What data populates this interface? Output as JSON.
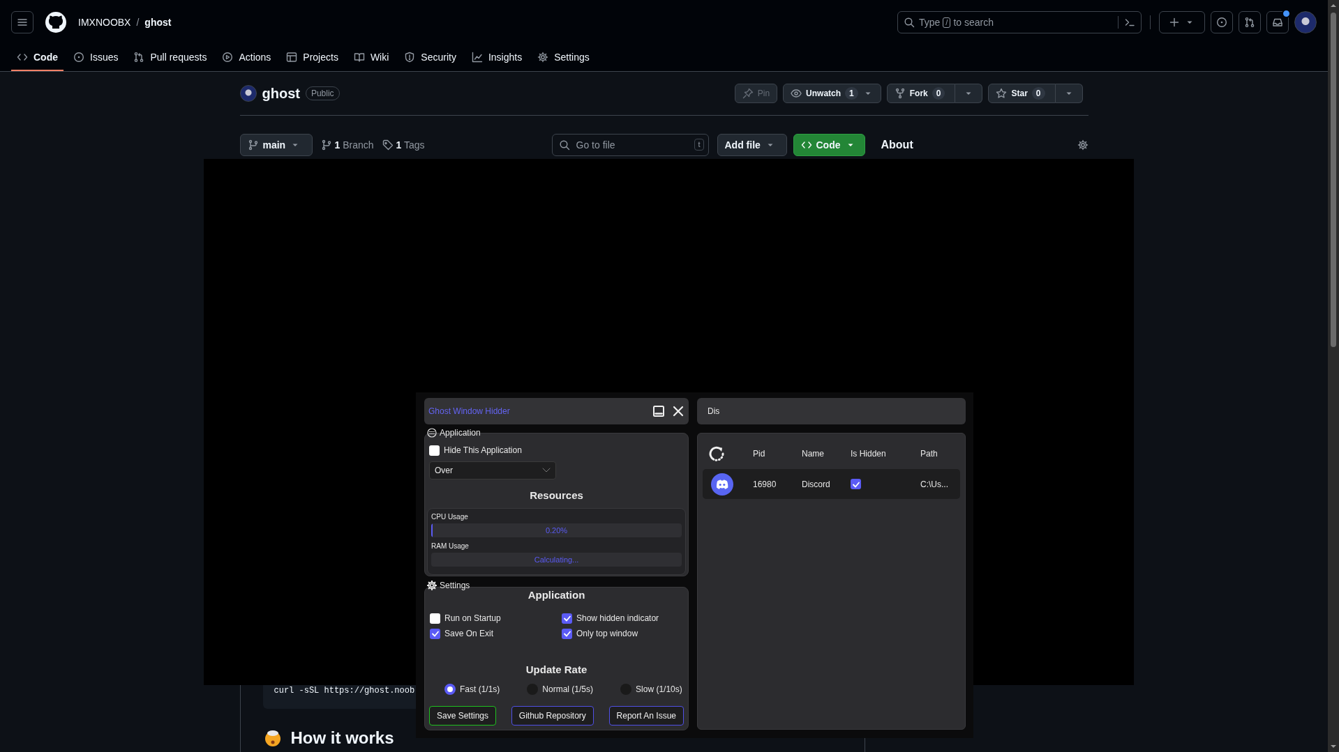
{
  "header": {
    "owner": "IMXNOOBX",
    "separator": "/",
    "repo": "ghost",
    "search": {
      "before": "Type",
      "key": "/",
      "after": "to search"
    },
    "unread": true
  },
  "nav": [
    {
      "kind": "code",
      "label": "Code",
      "selected": true
    },
    {
      "kind": "issues",
      "label": "Issues",
      "selected": false
    },
    {
      "kind": "pulls",
      "label": "Pull requests",
      "selected": false
    },
    {
      "kind": "actions",
      "label": "Actions",
      "selected": false
    },
    {
      "kind": "projects",
      "label": "Projects",
      "selected": false
    },
    {
      "kind": "wiki",
      "label": "Wiki",
      "selected": false
    },
    {
      "kind": "security",
      "label": "Security",
      "selected": false
    },
    {
      "kind": "insights",
      "label": "Insights",
      "selected": false
    },
    {
      "kind": "settings",
      "label": "Settings",
      "selected": false
    }
  ],
  "repo": {
    "name": "ghost",
    "visibility": "Public",
    "actions": [
      {
        "kind": "pin",
        "label": "Pin",
        "disabled": true
      },
      {
        "kind": "watch",
        "label": "Unwatch",
        "count": "1",
        "disabled": false
      },
      {
        "kind": "fork",
        "label": "Fork",
        "count": "0",
        "disabled": false
      },
      {
        "kind": "star",
        "label": "Star",
        "count": "0",
        "disabled": false
      }
    ]
  },
  "file_bar": {
    "branch": "main",
    "branches": "**1** Branch",
    "tags": "**1** Tags",
    "go_to_file": {
      "placeholder": "Go to file",
      "shortcut": "t"
    },
    "add_file": "Add file",
    "code": "Code",
    "about": "About"
  },
  "readme": {
    "code": "curl -sSL https://ghost.noob",
    "heading": "How it works"
  },
  "app": {
    "title": "Ghost Window Hidder",
    "application": {
      "label": "Application",
      "hide": {
        "label": "Hide This Application",
        "checked": false
      },
      "mode": "Over"
    },
    "resources": {
      "title": "Resources",
      "meters": [
        {
          "label": "CPU Usage",
          "level": 0.002,
          "reading": "0.20%"
        },
        {
          "label": "RAM Usage",
          "reading": "Calculating..."
        }
      ]
    },
    "settings": {
      "label": "Settings",
      "title": "Application",
      "options": [
        {
          "label": "Run on Startup",
          "checked": false
        },
        {
          "label": "Show hidden indicator",
          "checked": true
        },
        {
          "label": "Save On Exit",
          "checked": true
        },
        {
          "label": "Only top window",
          "checked": true
        }
      ],
      "rate_title": "Update Rate",
      "rates": [
        {
          "label": "Fast (1/1s)",
          "selected": true
        },
        {
          "label": "Normal (1/5s)",
          "selected": false
        },
        {
          "label": "Slow (1/10s)",
          "selected": false
        }
      ],
      "buttons": [
        {
          "kind": "save",
          "label": "Save Settings"
        },
        {
          "kind": "link",
          "label": "Github Repository"
        },
        {
          "kind": "link",
          "label": "Report An Issue"
        }
      ]
    }
  },
  "processes": {
    "search": "Dis",
    "columns": [
      "Pid",
      "Name",
      "Is Hidden",
      "Path"
    ],
    "rows": [
      {
        "pid": "16980",
        "name": "Discord",
        "hidden": true,
        "path": "C:\\Us..."
      }
    ]
  }
}
